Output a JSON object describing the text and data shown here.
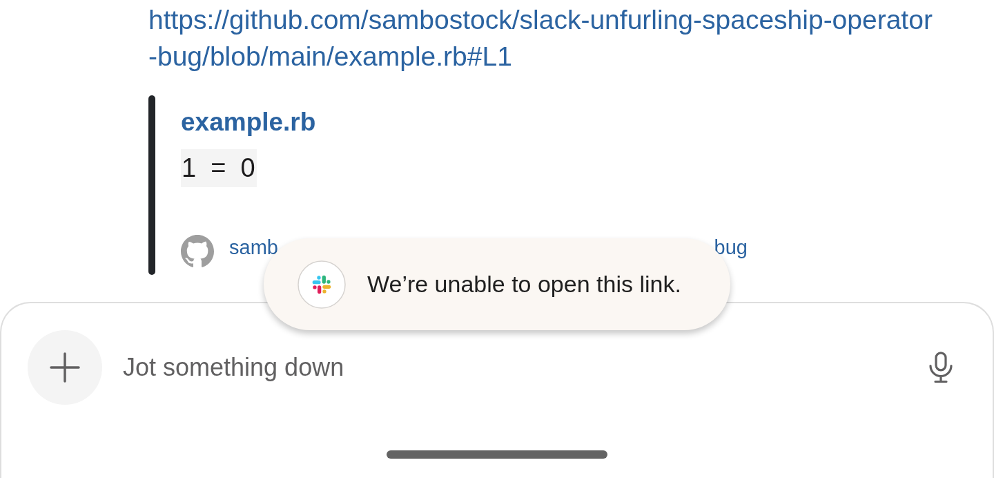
{
  "message": {
    "link_lines": [
      "https://github.com/sambostock/slack-unfurling-spaceship-operator",
      "-bug/blob/main/example.rb#L1"
    ],
    "attachment": {
      "title": "example.rb",
      "code": "1  =  0",
      "footer": {
        "text_start": "samb",
        "text_end": "bug"
      }
    }
  },
  "toast": {
    "text": "We’re unable to open this link."
  },
  "composer": {
    "placeholder": "Jot something down"
  }
}
